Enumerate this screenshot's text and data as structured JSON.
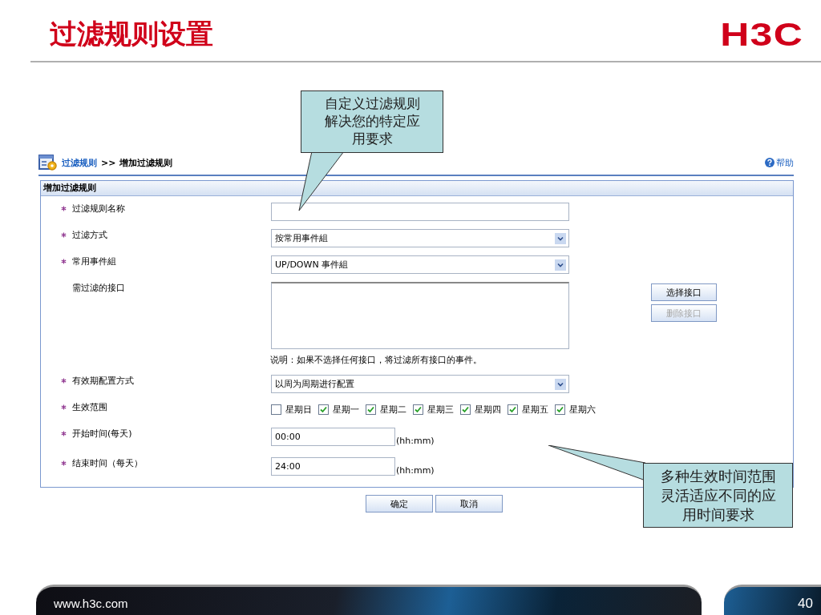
{
  "slide": {
    "title": "过滤规则设置",
    "logo": "H3C",
    "footer_url": "www.h3c.com",
    "page_number": "40"
  },
  "breadcrumb": {
    "link": "过滤规则",
    "separator": ">>",
    "current": "增加过滤规则",
    "help": "帮助"
  },
  "panel": {
    "title": "增加过滤规则",
    "fields": [
      {
        "kind": "text",
        "label": "过滤规则名称",
        "required": true
      },
      {
        "kind": "select",
        "label": "过滤方式",
        "required": true,
        "value": "按常用事件組"
      },
      {
        "kind": "select",
        "label": "常用事件組",
        "required": true,
        "value": "UP/DOWN 事件組"
      },
      {
        "kind": "listbox",
        "label": "需过滤的接口",
        "required": false,
        "buttons": [
          {
            "label": "选择接口",
            "disabled": false
          },
          {
            "label": "删除接口",
            "disabled": true
          }
        ],
        "note": "说明：如果不选择任何接口，将过滤所有接口的事件。"
      },
      {
        "kind": "select",
        "label": "有效期配置方式",
        "required": true,
        "value": "以周为周期进行配置"
      },
      {
        "kind": "days",
        "label": "生效范围",
        "required": true,
        "days": [
          {
            "label": "星期日",
            "checked": false
          },
          {
            "label": "星期一",
            "checked": true
          },
          {
            "label": "星期二",
            "checked": true
          },
          {
            "label": "星期三",
            "checked": true
          },
          {
            "label": "星期四",
            "checked": true
          },
          {
            "label": "星期五",
            "checked": true
          },
          {
            "label": "星期六",
            "checked": true
          }
        ]
      },
      {
        "kind": "time",
        "label": "开始时间(每天)",
        "required": true,
        "value": "00:00",
        "unit": "(hh:mm)"
      },
      {
        "kind": "time",
        "label": "结束时间（每天）",
        "required": true,
        "value": "24:00",
        "unit": "(hh:mm)"
      }
    ],
    "actions": [
      "确定",
      "取消"
    ]
  },
  "callouts": [
    {
      "text": "自定义过滤规则解决您的特定应用要求"
    },
    {
      "text": "多种生效时间范围灵活适应不同的应用时间要求"
    }
  ]
}
